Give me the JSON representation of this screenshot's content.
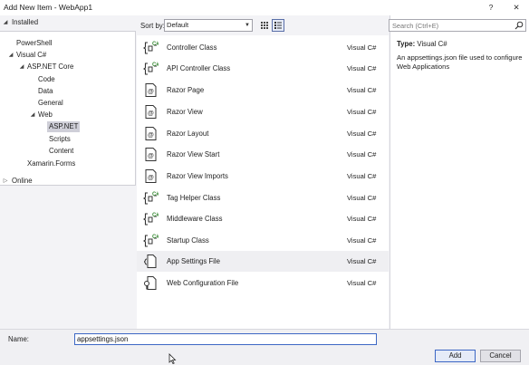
{
  "window": {
    "title": "Add New Item - WebApp1",
    "help_label": "?",
    "close_label": "✕"
  },
  "tree": {
    "installed_label": "Installed",
    "items": [
      {
        "label": "PowerShell"
      },
      {
        "label": "Visual C#"
      },
      {
        "label": "ASP.NET Core"
      },
      {
        "label": "Code"
      },
      {
        "label": "Data"
      },
      {
        "label": "General"
      },
      {
        "label": "Web"
      },
      {
        "label": "ASP.NET"
      },
      {
        "label": "Scripts"
      },
      {
        "label": "Content"
      },
      {
        "label": "Xamarin.Forms"
      }
    ],
    "online_label": "Online"
  },
  "toolbar": {
    "sort_label": "Sort by:",
    "sort_value": "Default"
  },
  "templates": [
    {
      "name": "Controller Class",
      "lang": "Visual C#",
      "icon": "csharp-class-icon"
    },
    {
      "name": "API Controller Class",
      "lang": "Visual C#",
      "icon": "csharp-class-icon"
    },
    {
      "name": "Razor Page",
      "lang": "Visual C#",
      "icon": "razor-icon"
    },
    {
      "name": "Razor View",
      "lang": "Visual C#",
      "icon": "razor-icon"
    },
    {
      "name": "Razor Layout",
      "lang": "Visual C#",
      "icon": "razor-icon"
    },
    {
      "name": "Razor View Start",
      "lang": "Visual C#",
      "icon": "razor-icon"
    },
    {
      "name": "Razor View Imports",
      "lang": "Visual C#",
      "icon": "razor-icon"
    },
    {
      "name": "Tag Helper Class",
      "lang": "Visual C#",
      "icon": "csharp-class-icon"
    },
    {
      "name": "Middleware Class",
      "lang": "Visual C#",
      "icon": "csharp-class-icon"
    },
    {
      "name": "Startup Class",
      "lang": "Visual C#",
      "icon": "csharp-class-icon"
    },
    {
      "name": "App Settings File",
      "lang": "Visual C#",
      "icon": "settings-file-icon"
    },
    {
      "name": "Web Configuration File",
      "lang": "Visual C#",
      "icon": "config-file-icon"
    }
  ],
  "details": {
    "search_placeholder": "Search (Ctrl+E)",
    "type_label": "Type:",
    "type_value": "Visual C#",
    "description": "An appsettings.json file used to configure Web Applications"
  },
  "footer": {
    "name_label": "Name:",
    "name_value": "appsettings.json",
    "add_label": "Add",
    "cancel_label": "Cancel"
  },
  "colors": {
    "accent": "#3c67c4",
    "csharp_green": "#388a34",
    "selection": "#cfcfd8"
  }
}
